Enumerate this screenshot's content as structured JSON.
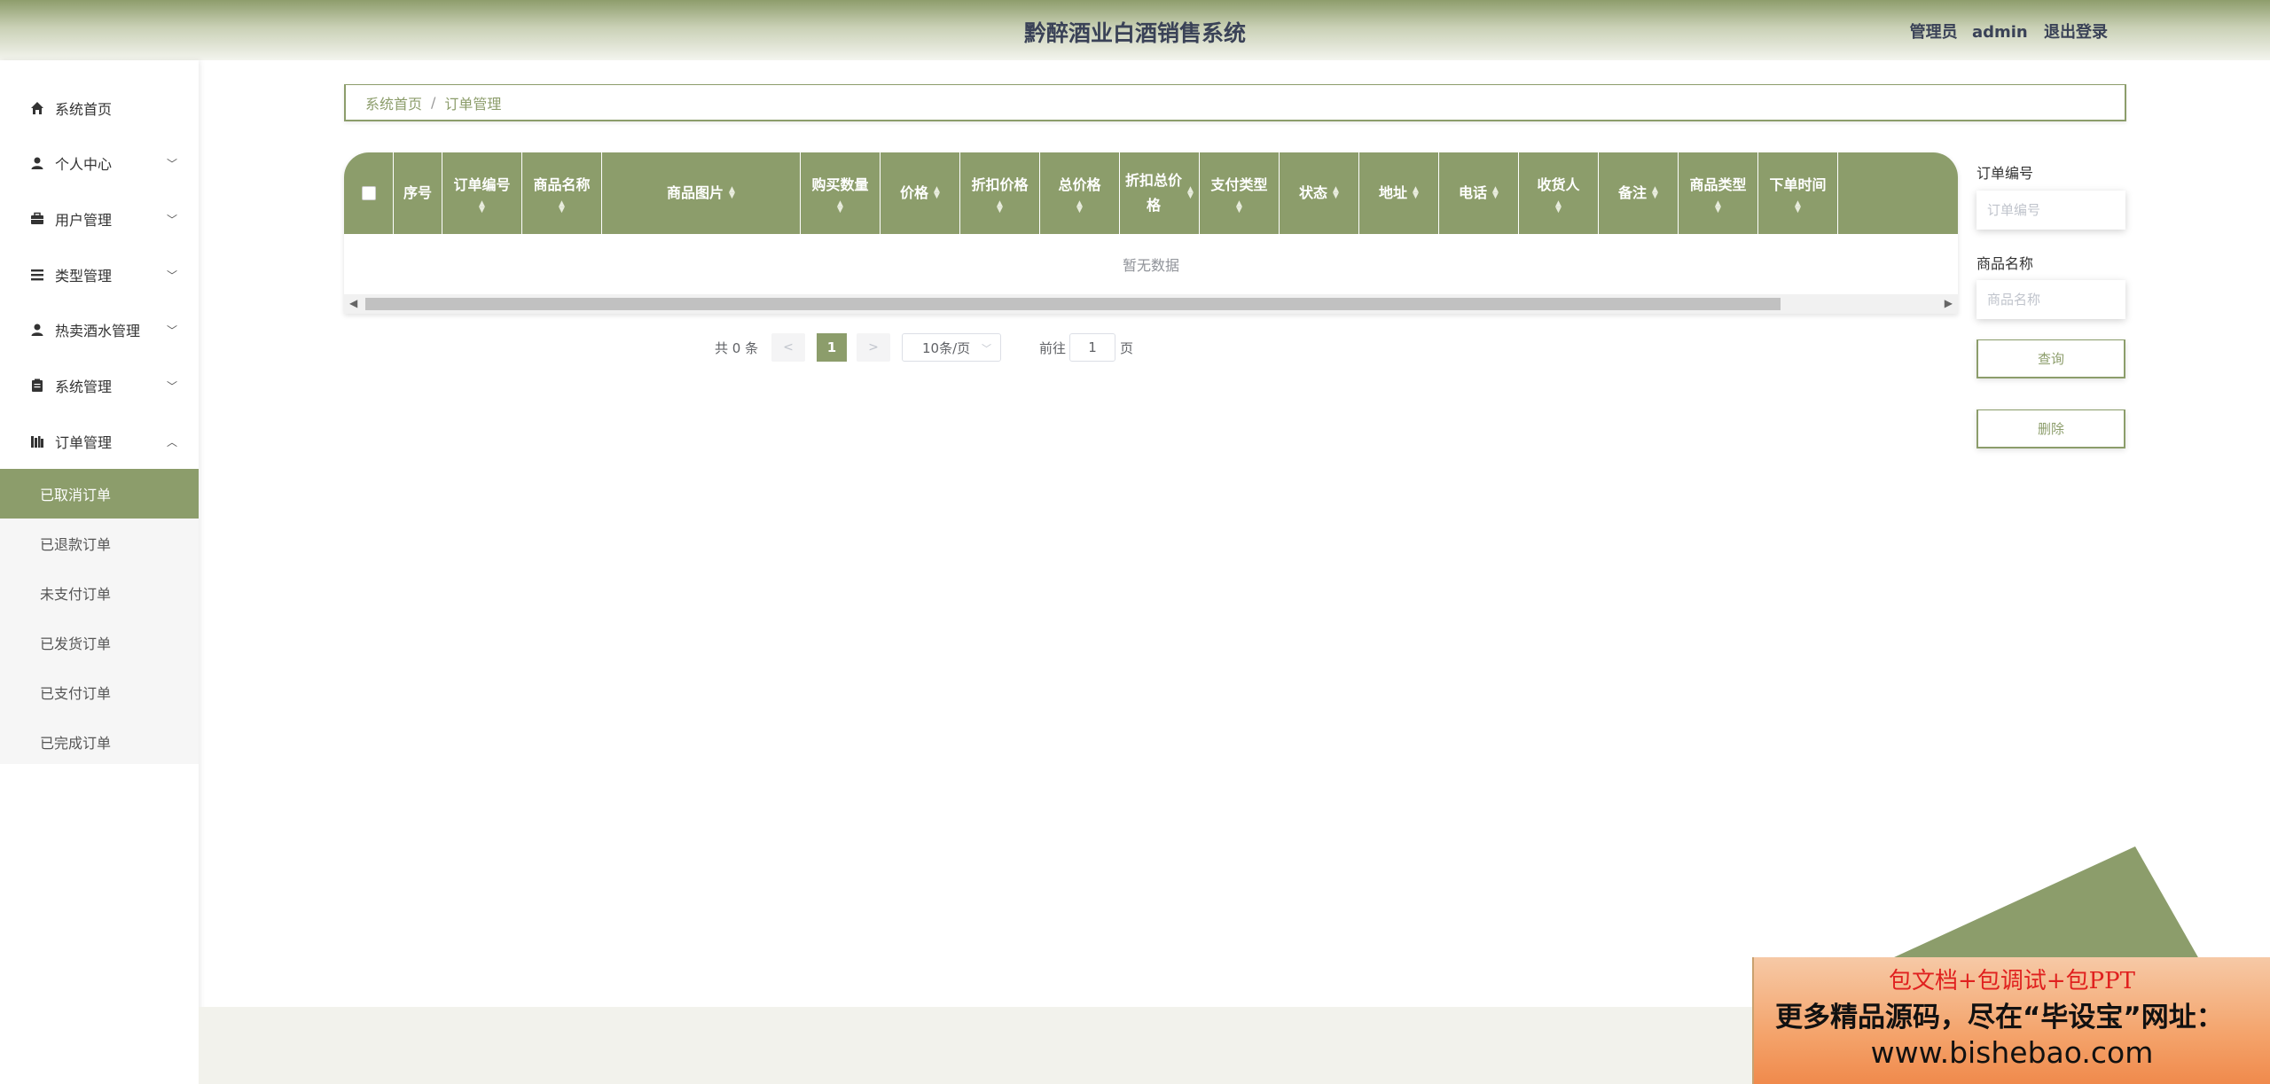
{
  "header": {
    "title": "黔醉酒业白酒销售系统",
    "role": "管理员",
    "username": "admin",
    "logout": "退出登录"
  },
  "sidebar": {
    "items": [
      {
        "label": "系统首页",
        "icon": "home-icon"
      },
      {
        "label": "个人中心",
        "icon": "user-icon"
      },
      {
        "label": "用户管理",
        "icon": "briefcase-icon"
      },
      {
        "label": "类型管理",
        "icon": "list-icon"
      },
      {
        "label": "热卖酒水管理",
        "icon": "user-icon"
      },
      {
        "label": "系统管理",
        "icon": "clipboard-icon"
      },
      {
        "label": "订单管理",
        "icon": "books-icon"
      }
    ],
    "sub_items": [
      "已取消订单",
      "已退款订单",
      "未支付订单",
      "已发货订单",
      "已支付订单",
      "已完成订单"
    ],
    "active_sub": "已取消订单"
  },
  "breadcrumb": {
    "home": "系统首页",
    "sep": "/",
    "current": "订单管理"
  },
  "table": {
    "columns": [
      "序号",
      "订单编号",
      "商品名称",
      "商品图片",
      "购买数量",
      "价格",
      "折扣价格",
      "总价格",
      "折扣总价格",
      "支付类型",
      "状态",
      "地址",
      "电话",
      "收货人",
      "备注",
      "商品类型",
      "下单时间"
    ],
    "empty_text": "暂无数据"
  },
  "pagination": {
    "total_text": "共 0 条",
    "prev": "<",
    "next": ">",
    "current_page": "1",
    "page_size": "10条/页",
    "goto_prefix": "前往",
    "goto_value": "1",
    "goto_suffix": "页"
  },
  "filters": {
    "order_no_label": "订单编号",
    "order_no_placeholder": "订单编号",
    "product_name_label": "商品名称",
    "product_name_placeholder": "商品名称",
    "query_button": "查询",
    "delete_button": "删除"
  },
  "banner": {
    "line1": "包文档+包调试+包PPT",
    "line2": "更多精品源码，尽在“毕设宝”网址：",
    "line3": "www.bishebao.com"
  },
  "colors": {
    "accent": "#8c9d6b",
    "title": "#3a4257"
  }
}
